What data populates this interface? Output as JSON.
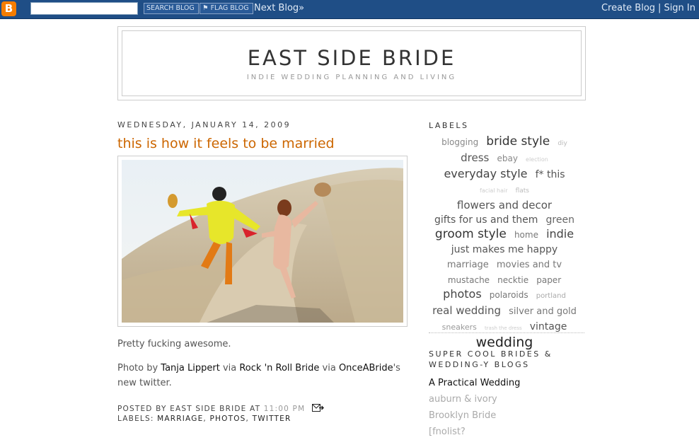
{
  "navbar": {
    "logo": "B",
    "search_value": "",
    "search_button": "SEARCH BLOG",
    "flag_button": "FLAG BLOG",
    "next_blog": "Next Blog»",
    "create_blog": "Create Blog",
    "separator": "|",
    "sign_in": "Sign In"
  },
  "header": {
    "title": "EAST SIDE BRIDE",
    "description": "INDIE WEDDING PLANNING AND LIVING"
  },
  "post": {
    "date": "WEDNESDAY, JANUARY 14, 2009",
    "title": "this is how it feels to be married",
    "body_1": "Pretty fucking awesome.",
    "photo_by": "Photo by ",
    "photographer": "Tanja Lippert",
    "via1": " via ",
    "source1": "Rock 'n Roll Bride",
    "via2": " via ",
    "source2": "OnceABride",
    "suffix": "'s new twitter.",
    "posted_by_label": "POSTED BY EAST SIDE BRIDE AT ",
    "time": "11:00 PM",
    "labels_prefix": "LABELS: ",
    "labels": [
      "MARRIAGE",
      "PHOTOS",
      "TWITTER"
    ],
    "labels_sep": ", "
  },
  "sidebar": {
    "labels_heading": "LABELS",
    "cloud": [
      {
        "text": "blogging",
        "size": 12,
        "color": "#888"
      },
      {
        "text": "bride style",
        "size": 17,
        "color": "#333"
      },
      {
        "text": "diy",
        "size": 9,
        "color": "#bbb"
      },
      {
        "text": "dress",
        "size": 15,
        "color": "#555"
      },
      {
        "text": "ebay",
        "size": 12,
        "color": "#888"
      },
      {
        "text": "election",
        "size": 8,
        "color": "#ccc"
      },
      {
        "text": "everyday style",
        "size": 16,
        "color": "#444"
      },
      {
        "text": "f* this",
        "size": 14,
        "color": "#555"
      },
      {
        "text": "facial hair",
        "size": 8,
        "color": "#ccc"
      },
      {
        "text": "flats",
        "size": 9,
        "color": "#bbb"
      },
      {
        "text": "flowers and decor",
        "size": 15,
        "color": "#555"
      },
      {
        "text": "gifts for us and them",
        "size": 14,
        "color": "#555"
      },
      {
        "text": "green",
        "size": 14,
        "color": "#666"
      },
      {
        "text": "groom style",
        "size": 17,
        "color": "#333"
      },
      {
        "text": "home",
        "size": 12,
        "color": "#777"
      },
      {
        "text": "indie",
        "size": 16,
        "color": "#444"
      },
      {
        "text": "just makes me happy",
        "size": 14,
        "color": "#555"
      },
      {
        "text": "marriage",
        "size": 13,
        "color": "#777"
      },
      {
        "text": "movies and tv",
        "size": 13,
        "color": "#777"
      },
      {
        "text": "mustache",
        "size": 12,
        "color": "#777"
      },
      {
        "text": "necktie",
        "size": 12,
        "color": "#777"
      },
      {
        "text": "paper",
        "size": 12,
        "color": "#777"
      },
      {
        "text": "photos",
        "size": 16,
        "color": "#444"
      },
      {
        "text": "polaroids",
        "size": 12,
        "color": "#777"
      },
      {
        "text": "portland",
        "size": 10,
        "color": "#aaa"
      },
      {
        "text": "real wedding",
        "size": 15,
        "color": "#555"
      },
      {
        "text": "silver and gold",
        "size": 13,
        "color": "#777"
      },
      {
        "text": "sneakers",
        "size": 11,
        "color": "#999"
      },
      {
        "text": "trash the dress",
        "size": 7,
        "color": "#ccc"
      },
      {
        "text": "vintage",
        "size": 14,
        "color": "#555"
      },
      {
        "text": "wedding",
        "size": 19,
        "color": "#222"
      }
    ],
    "blogs_heading_1": "SUPER COOL BRIDES &",
    "blogs_heading_2": "WEDDING-Y BLOGS",
    "blogs": [
      {
        "text": "A Practical Wedding",
        "dark": true
      },
      {
        "text": "auburn & ivory",
        "dark": false
      },
      {
        "text": "Brooklyn Bride",
        "dark": false
      },
      {
        "text": "[fnolist?",
        "dark": false
      }
    ]
  }
}
